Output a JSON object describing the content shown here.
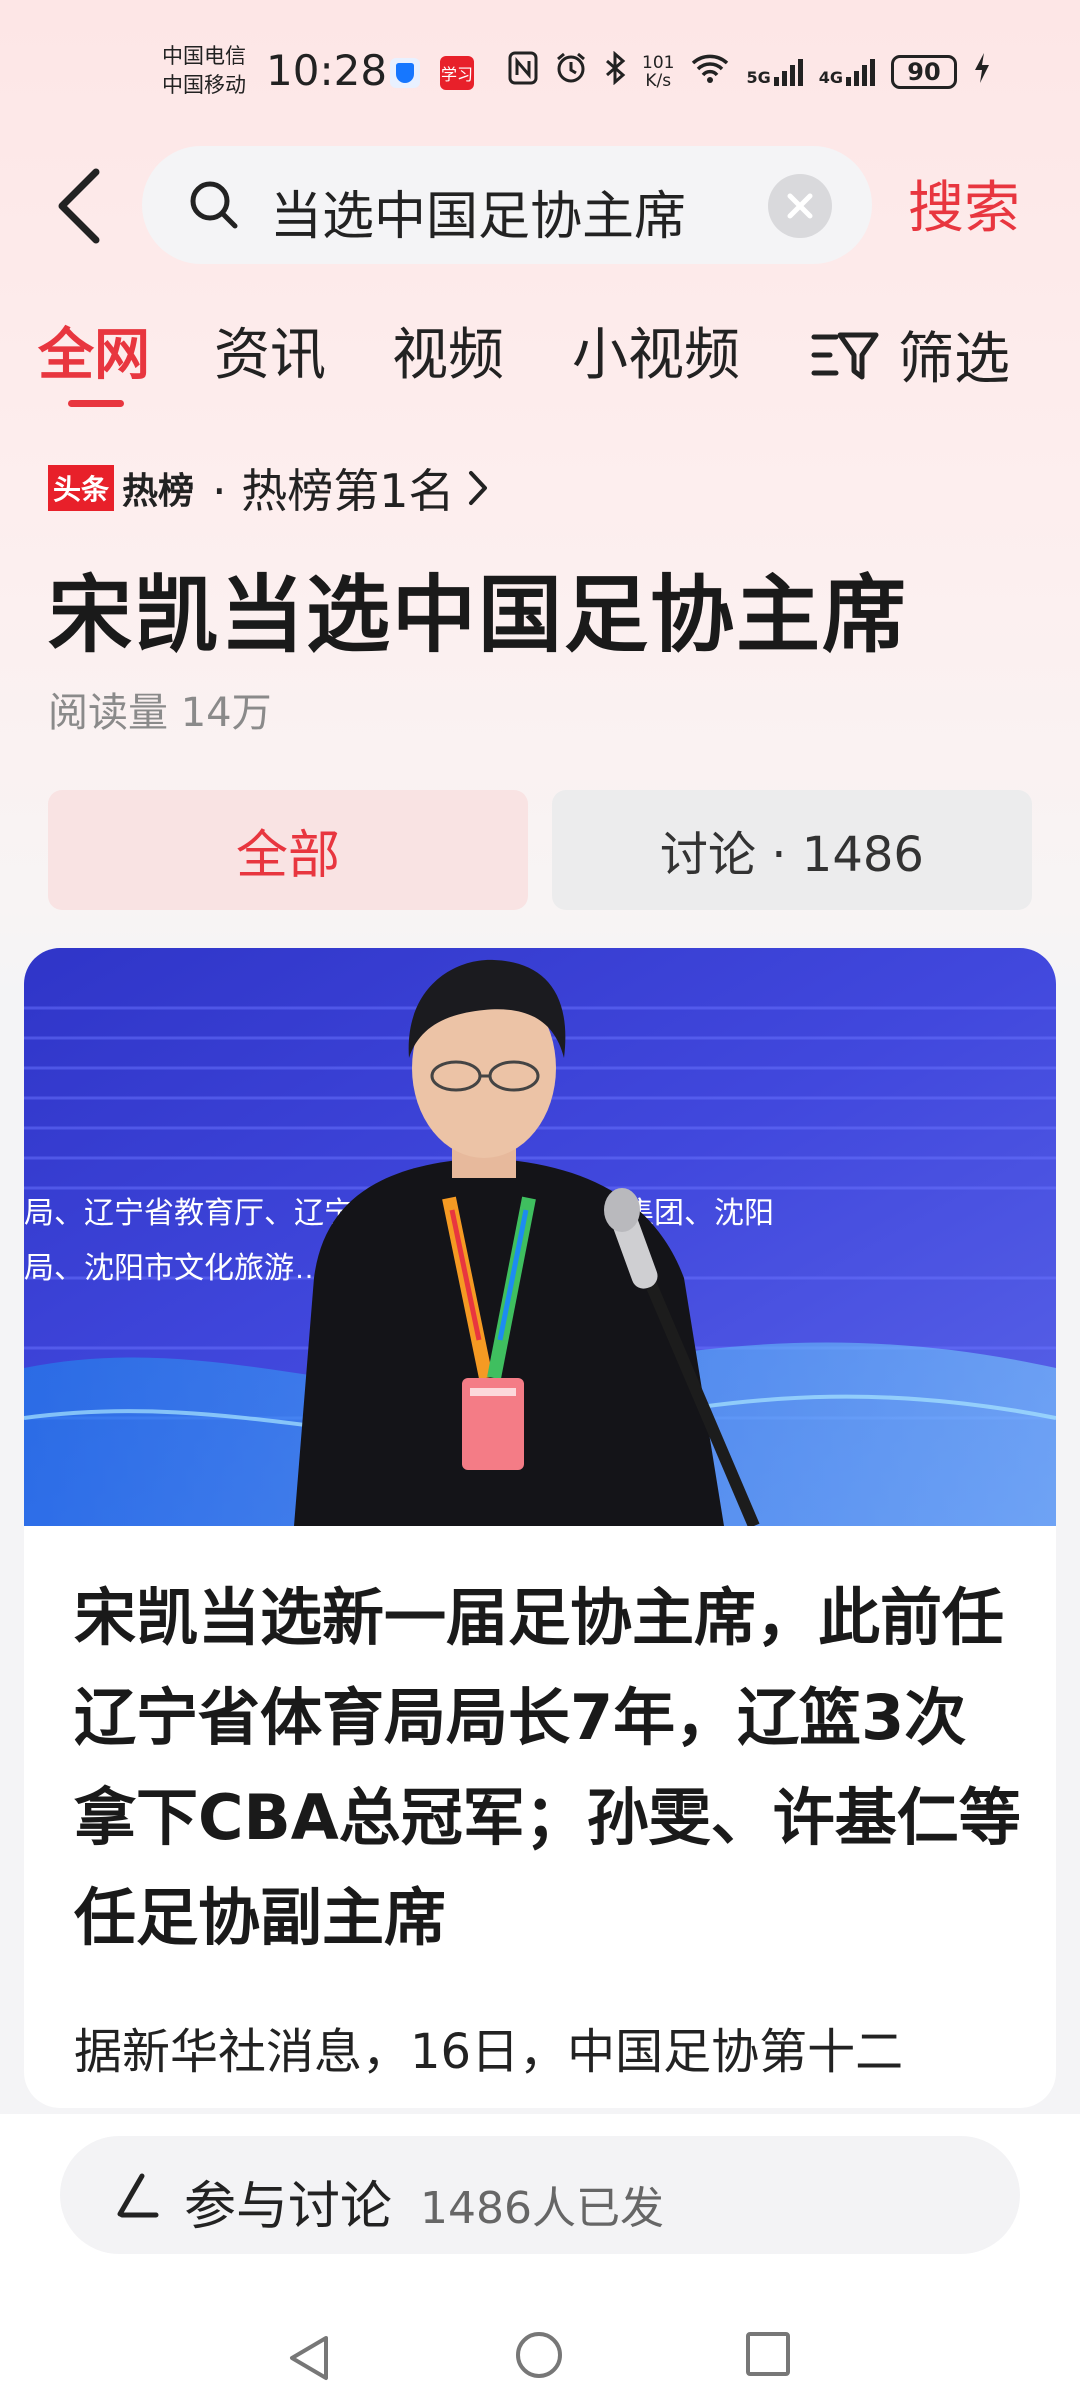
{
  "status_bar": {
    "carrier1": "中国电信",
    "carrier2": "中国移动",
    "time": "10:28",
    "app2_label": "学习",
    "net_speed_value": "101",
    "net_speed_unit": "K/s",
    "signal1": "5G",
    "signal2": "4G",
    "battery": "90"
  },
  "search": {
    "query": "当选中国足协主席",
    "submit_label": "搜索"
  },
  "tabs": [
    {
      "label": "全网",
      "active": true
    },
    {
      "label": "资讯"
    },
    {
      "label": "视频"
    },
    {
      "label": "小视频"
    }
  ],
  "filter_label": "筛选",
  "hot_list": {
    "badge": "头条",
    "word": "热榜",
    "rank_text": "· 热榜第1名"
  },
  "topic": {
    "title": "宋凯当选中国足协主席",
    "read_count": "阅读量 14万"
  },
  "segments": {
    "all_label": "全部",
    "discuss_label": "讨论 · 1486"
  },
  "article": {
    "title": "宋凯当选新一届足协主席，此前任辽宁省体育局局长7年，辽篮3次拿下CBA总冠军；孙雯、许基仁等任足协副主席",
    "snippet": "据新华社消息，16日，中国足协第十二",
    "image_banner_text1": "局、辽宁省教育厅、辽宁省…辽宁省体育产业集团、沈阳",
    "image_banner_text2": "局、沈阳市文化旅游…体育局、中共苏家屯"
  },
  "discussion": {
    "label": "参与讨论",
    "count_text": "1486人已发"
  },
  "colors": {
    "accent": "#e8363f",
    "page_bg_top": "#fde6e6",
    "photo_bg": "#3a3fd0"
  }
}
